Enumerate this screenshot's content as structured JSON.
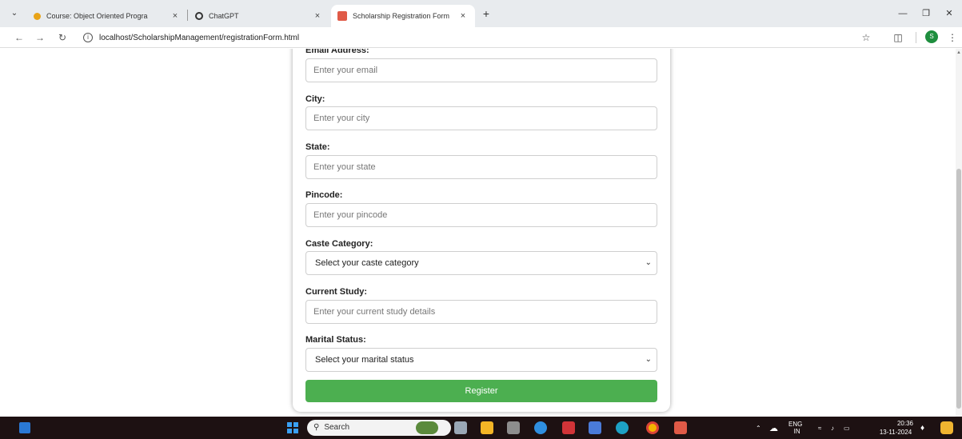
{
  "browser": {
    "tabs": [
      {
        "title": "Course: Object Oriented Progra",
        "favicon_color": "#e8a317",
        "active": false
      },
      {
        "title": "ChatGPT",
        "favicon_color": "#333333",
        "active": false
      },
      {
        "title": "Scholarship Registration Form",
        "favicon_color": "#e05a47",
        "active": true
      }
    ],
    "close_glyph": "×",
    "new_tab_glyph": "+",
    "url": "localhost/ScholarshipManagement/registrationForm.html",
    "profile_initial": "S"
  },
  "form": {
    "fields": [
      {
        "label": "Email Address:",
        "placeholder": "Enter your email",
        "type": "input"
      },
      {
        "label": "City:",
        "placeholder": "Enter your city",
        "type": "input"
      },
      {
        "label": "State:",
        "placeholder": "Enter your state",
        "type": "input"
      },
      {
        "label": "Pincode:",
        "placeholder": "Enter your pincode",
        "type": "input"
      },
      {
        "label": "Caste Category:",
        "placeholder": "Select your caste category",
        "type": "select"
      },
      {
        "label": "Current Study:",
        "placeholder": "Enter your current study details",
        "type": "input"
      },
      {
        "label": "Marital Status:",
        "placeholder": "Select your marital status",
        "type": "select"
      }
    ],
    "register_label": "Register",
    "accent_color": "#4caf50"
  },
  "taskbar": {
    "search_label": "Search",
    "language": "ENG",
    "region": "IN",
    "time": "20:36",
    "date": "13-11-2024"
  }
}
